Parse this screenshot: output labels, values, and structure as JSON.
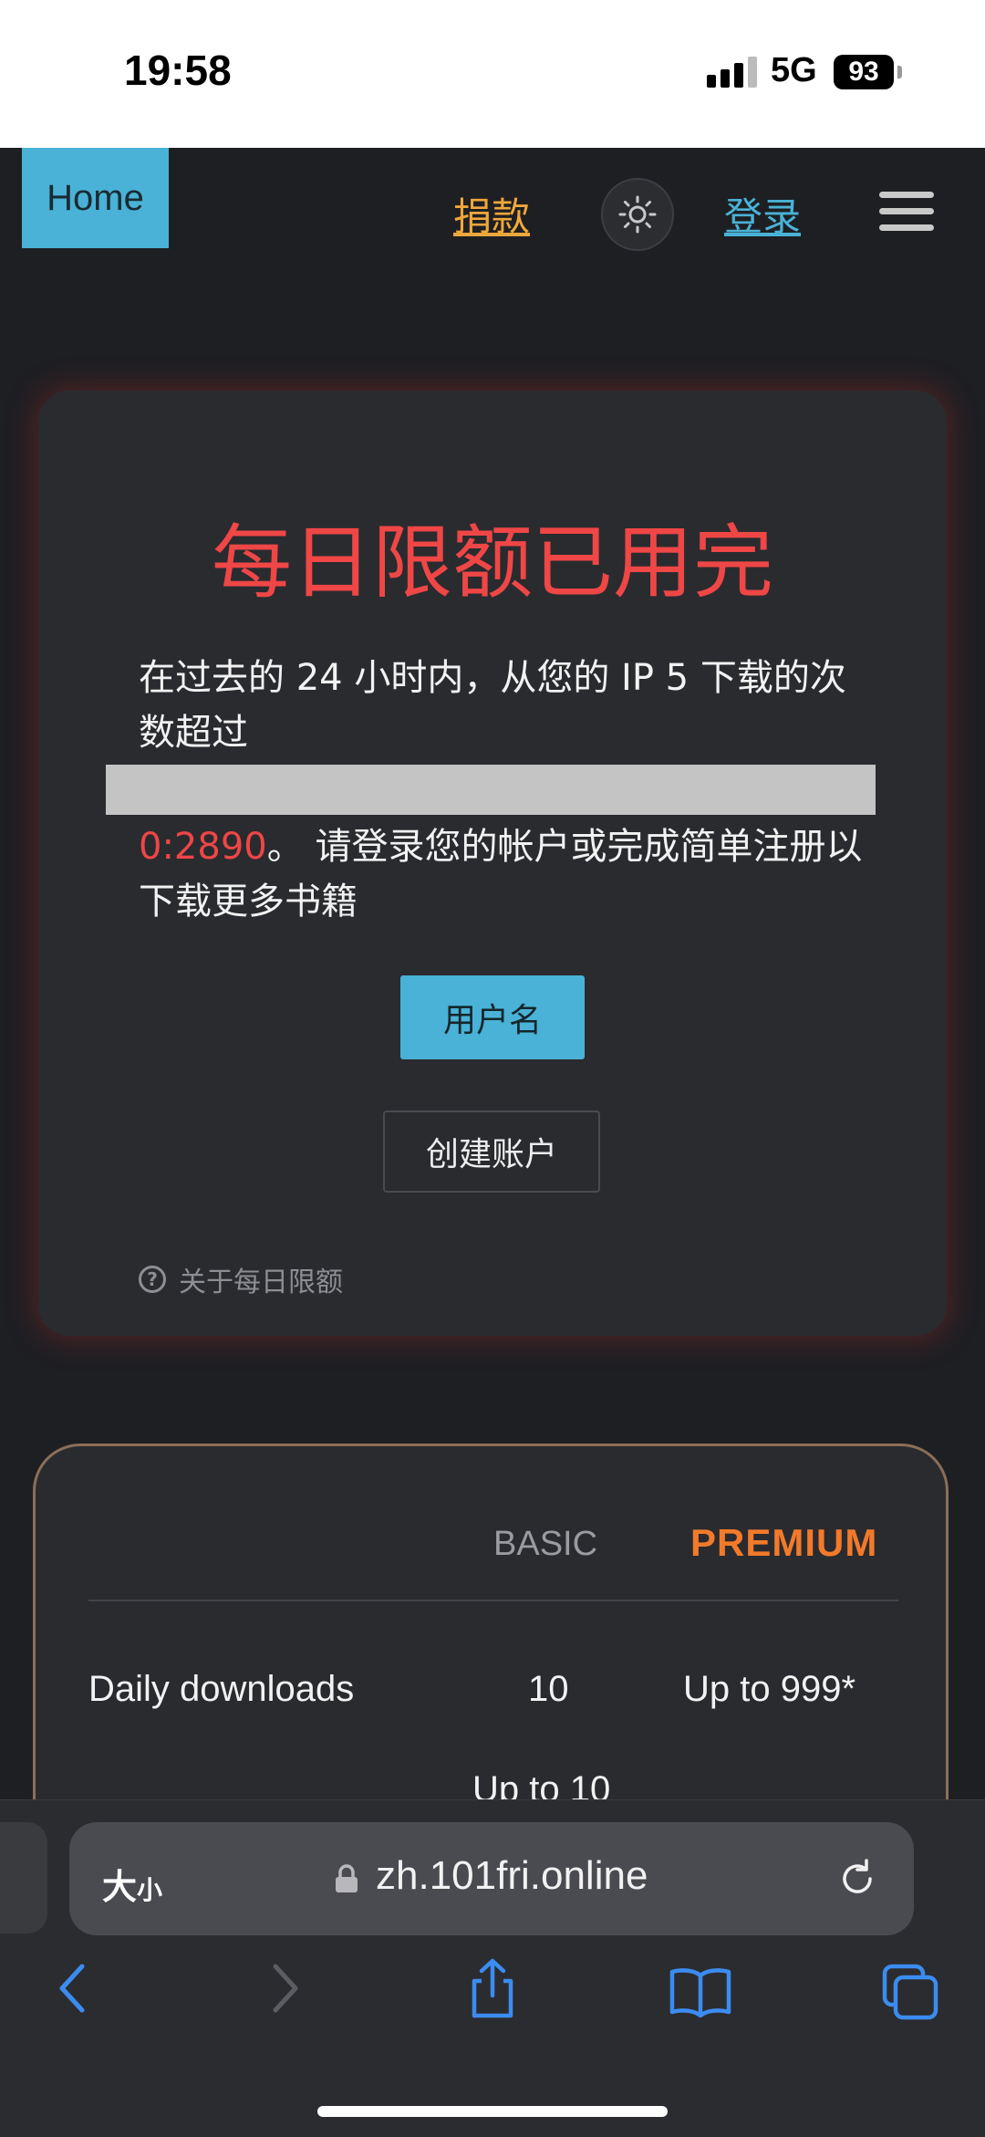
{
  "status_bar": {
    "time": "19:58",
    "network": "5G",
    "battery": "93"
  },
  "header": {
    "home": "Home",
    "donate": "捐款",
    "login": "登录"
  },
  "limit_card": {
    "title": "每日限额已用完",
    "text_part1": "在过去的 24 小时内，从您的 IP 5 下载的次数超过",
    "count": "0:2890",
    "text_part2": "。 请登录您的帐户或完成简单注册以下载更多书籍",
    "username_button": "用户名",
    "create_account_button": "创建账户",
    "about_link": "关于每日限额"
  },
  "pricing": {
    "basic_label": "BASIC",
    "premium_label": "PREMIUM",
    "rows": [
      {
        "label": "Daily downloads",
        "basic": "10",
        "premium": "Up to 999*"
      },
      {
        "label": "",
        "basic": "Up to 10",
        "premium": ""
      }
    ]
  },
  "browser": {
    "text_size": "大",
    "text_size_small": "小",
    "url": "zh.101fri.online"
  },
  "colors": {
    "accent_blue": "#49b2d6",
    "alert_red": "#ef4646",
    "donate_orange": "#f0a73a"
  }
}
